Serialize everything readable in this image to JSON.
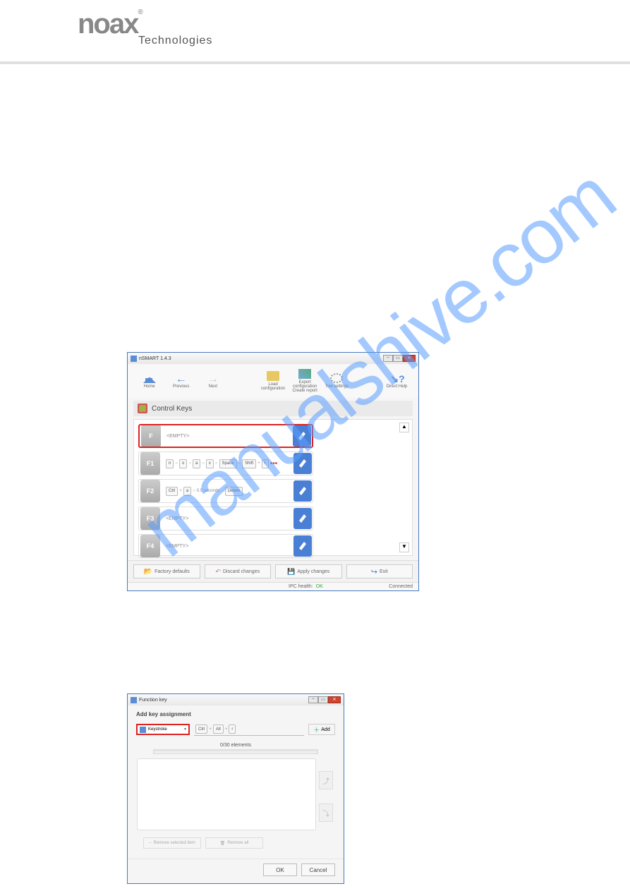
{
  "brand": {
    "name": "noax",
    "sub": "Technologies",
    "reg": "®"
  },
  "watermark": "manualshive.com",
  "win1": {
    "title": "nSMART 1.4.3",
    "toolbar": {
      "home": "Home",
      "previous": "Previous",
      "next": "Next",
      "load": "Load configuration",
      "export": "Export configuration\nCreate report",
      "tool": "Tool settings",
      "help": "Direct Help"
    },
    "section_title": "Control Keys",
    "rows": [
      {
        "key": "F",
        "assignment": {
          "type": "empty",
          "text": "<EMPTY>"
        },
        "highlight": true
      },
      {
        "key": "F1",
        "assignment": {
          "type": "seq",
          "parts": [
            "n",
            "○",
            "o",
            "○",
            "a",
            "○",
            "x",
            "○",
            "Space",
            "○",
            "Shift",
            "+",
            "I",
            "dots"
          ]
        }
      },
      {
        "key": "F2",
        "assignment": {
          "type": "seq",
          "parts": [
            "Ctrl",
            "+",
            "a",
            "○",
            "0.5 seconds",
            "○",
            "Delete"
          ]
        }
      },
      {
        "key": "F3",
        "assignment": {
          "type": "empty",
          "text": "<EMPTY>"
        }
      },
      {
        "key": "F4",
        "assignment": {
          "type": "empty",
          "text": "<EMPTY>"
        }
      }
    ],
    "bottom": {
      "factory": "Factory defaults",
      "discard": "Discard changes",
      "apply": "Apply changes",
      "exit": "Exit"
    },
    "status": {
      "health_label": "IPC health:",
      "health_val": "OK",
      "conn": "Connected"
    }
  },
  "win2": {
    "title": "Function key",
    "heading": "Add key assignment",
    "combo_value": "Keystroke",
    "add_parts": [
      "Ctrl",
      "+",
      "Alt",
      "+",
      "r"
    ],
    "add_label": "Add",
    "elements": "0/30 elements",
    "remove_sel": "Remove selected item",
    "remove_all": "Remove all",
    "ok": "OK",
    "cancel": "Cancel"
  }
}
